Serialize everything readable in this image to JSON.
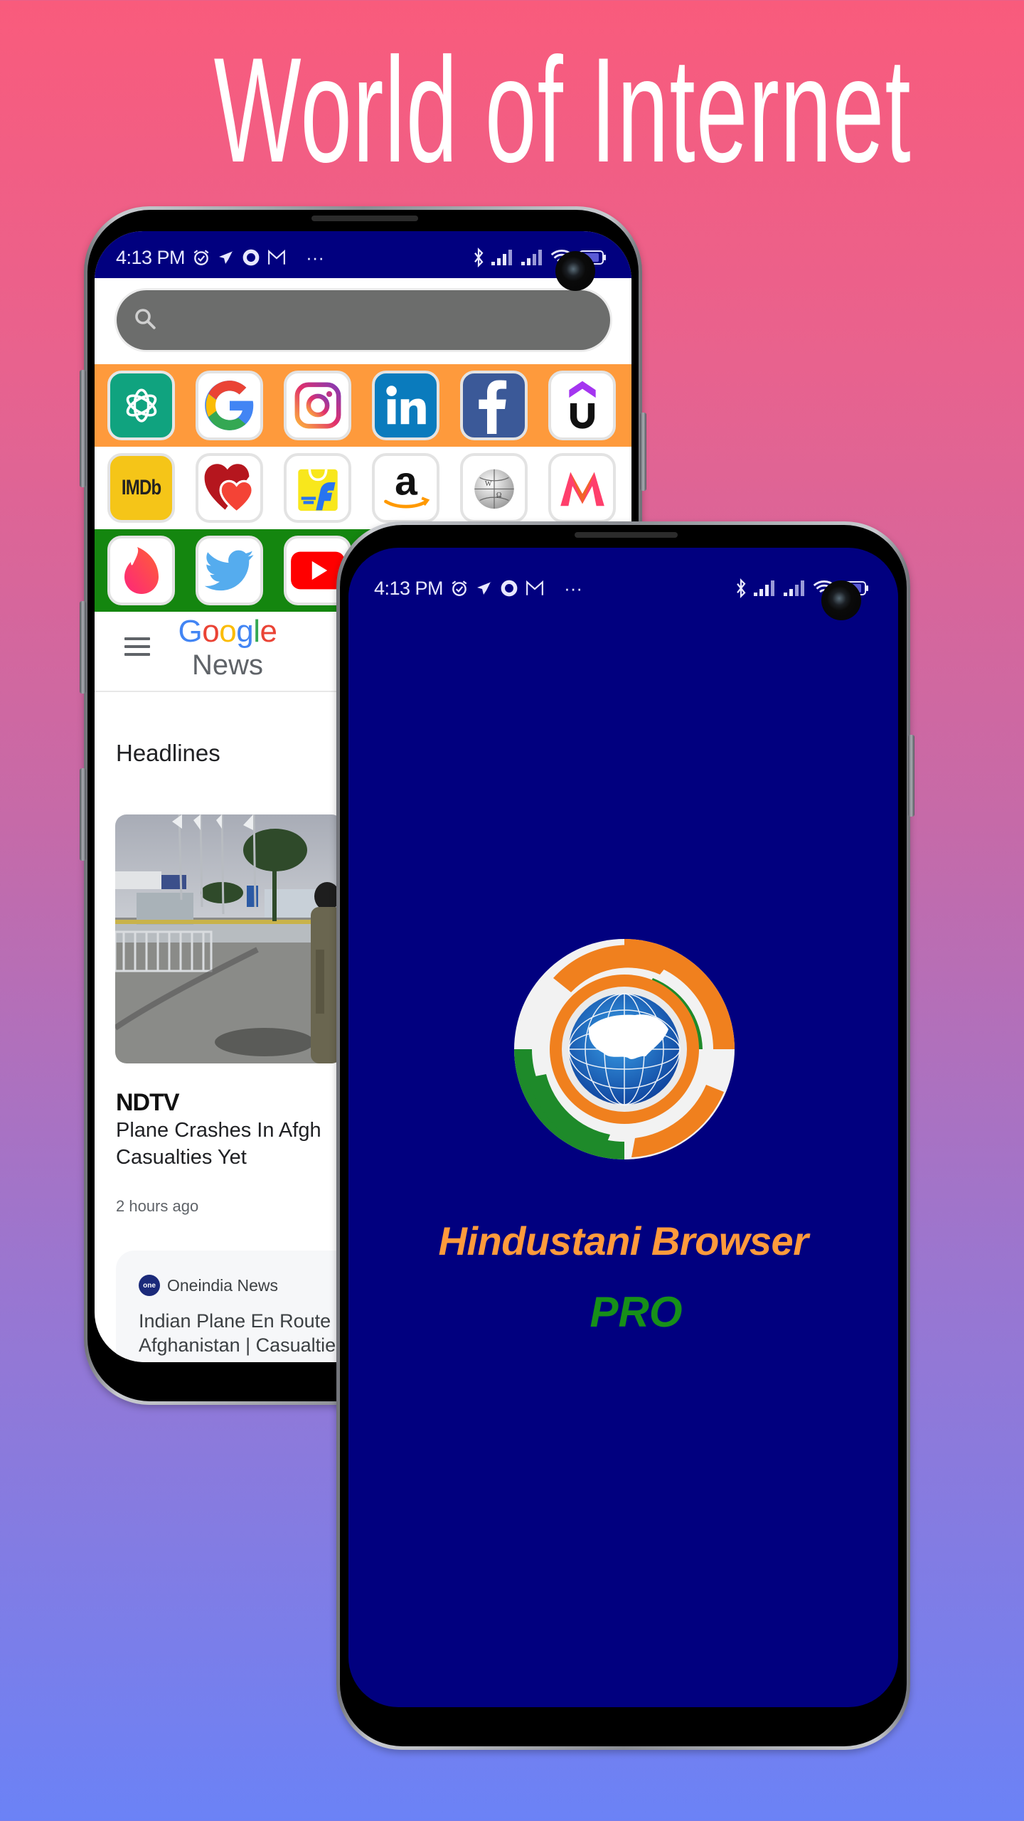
{
  "headline": "World of Internet",
  "colors": {
    "navy": "#01007f",
    "saffron": "#fe9a3c",
    "green": "#14860f",
    "brand_orange": "#ff9a3c",
    "brand_green": "#179019"
  },
  "status_bar": {
    "time": "4:13 PM",
    "left_icons": [
      "alarm-icon",
      "telegram-icon",
      "circle-app-icon",
      "gmail-icon",
      "more-dots-icon"
    ],
    "right_icons": [
      "bluetooth-icon",
      "signal-icon",
      "signal-icon",
      "wifi-icon",
      "battery-icon"
    ],
    "more": "···"
  },
  "browser_home": {
    "search": {
      "placeholder": "",
      "value": ""
    },
    "app_rows": [
      {
        "color": "orange",
        "apps": [
          "ChatGPT",
          "Google",
          "Instagram",
          "LinkedIn",
          "Facebook",
          "Udemy"
        ]
      },
      {
        "color": "white",
        "apps": [
          "IMDb",
          "Dating",
          "Flipkart",
          "Amazon",
          "Wikipedia",
          "Myntra"
        ]
      },
      {
        "color": "green",
        "apps": [
          "Tinder",
          "Twitter",
          "YouTube"
        ]
      }
    ],
    "imdb_label": "IMDb",
    "google_news": {
      "google": [
        "G",
        "o",
        "o",
        "g",
        "l",
        "e"
      ],
      "news": "News",
      "section": "Headlines",
      "articles": [
        {
          "source": "NDTV",
          "title_lines": [
            "Plane Crashes In Afgh",
            "Casualties Yet"
          ],
          "time": "2 hours ago"
        },
        {
          "source": "Oneindia News",
          "source_logo": "one",
          "title_lines": [
            "Indian Plane En Route t",
            "Afghanistan | Casualtie"
          ]
        }
      ]
    }
  },
  "splash": {
    "title": "Hindustani Browser",
    "subtitle": "PRO"
  }
}
